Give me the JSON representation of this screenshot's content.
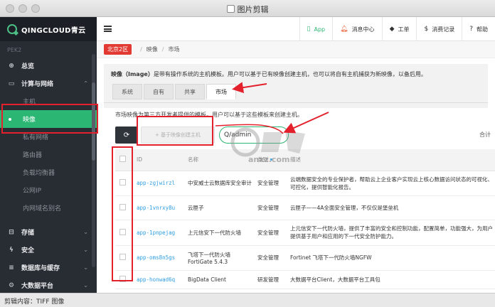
{
  "window": {
    "title": "图片剪辑"
  },
  "status_bar": {
    "text": "剪辑内容：TIFF 图像"
  },
  "sidebar": {
    "logo": "QINGCLOUD青云",
    "region": "PEK2",
    "items": [
      {
        "label": "总览",
        "icon": "dashboard-icon",
        "glyph": "⊕"
      },
      {
        "label": "计算与网络",
        "icon": "monitor-icon",
        "glyph": "▭",
        "chevron": "⌃"
      },
      {
        "label": "主机"
      },
      {
        "label": "映像"
      },
      {
        "label": "私有网络"
      },
      {
        "label": "路由器"
      },
      {
        "label": "负载均衡器"
      },
      {
        "label": "公网IP"
      },
      {
        "label": "内网域名别名"
      },
      {
        "label": "存储",
        "icon": "storage-icon",
        "glyph": "⊟",
        "chevron": "⌄"
      },
      {
        "label": "安全",
        "icon": "lightning-icon",
        "glyph": "ϟ",
        "chevron": "⌄"
      },
      {
        "label": "数据库与缓存",
        "icon": "database-icon",
        "glyph": "≡",
        "chevron": "⌄"
      },
      {
        "label": "大数据平台",
        "icon": "gear-icon",
        "glyph": "⚙",
        "chevron": "⌄"
      }
    ]
  },
  "header": {
    "app": "App",
    "messages": "消息中心",
    "tickets": "工单",
    "billing": "消费记录",
    "help": "帮助"
  },
  "breadcrumb": {
    "region": "北京2区",
    "section": "映像",
    "page": "市场"
  },
  "intro": {
    "bold": "映像（Image）",
    "text": "是带有操作系统的主机模板。用户可以基于已有映像创建主机，也可以将自有主机捕获为新映像，以备后用。"
  },
  "tabs": [
    "系统",
    "自有",
    "共享",
    "市场"
  ],
  "market_desc": "市场映像为第三方开发者提供的模板。用户可以基于这些模板来创建主机。",
  "toolbar": {
    "refresh_glyph": "⟳",
    "create_label": "+ 基于映像创建主机",
    "search_value": "Q/admin",
    "total_label": "合计"
  },
  "table": {
    "columns": [
      "ID",
      "名称",
      "类别",
      "描述"
    ],
    "rows": [
      {
        "id": "app-zgjwirzl",
        "name": "中安威士云数据库安全审计",
        "category": "安全管理",
        "desc": "云端数据安全的专业保护者，帮助云上企业客户实现云上核心数据访问状态的可视化、可控化，提供智能化报告。"
      },
      {
        "id": "app-1vnrxy8u",
        "name": "云匣子",
        "category": "安全管理",
        "desc": "云匣子——4A全面安全管理，不仅仅是堡垒机"
      },
      {
        "id": "app-1pnpejag",
        "name": "上元信安下一代防火墙",
        "category": "安全管理",
        "desc": "上元信安下一代防火墙，提供了丰富的安全和控制功能，配置简单，功能强大，为用户提供基于用户和应用的下一代安全防护能力。"
      },
      {
        "id": "app-oms8n5gs",
        "name": "飞塔下一代防火墙 FortiGate 5.4.3",
        "category": "安全管理",
        "desc": "Fortinet 飞塔下一代防火墙NGFW"
      },
      {
        "id": "app-honwad6q",
        "name": "BigData Client",
        "category": "研发管理",
        "desc": "大数据平台Client，大数据平台工具包"
      }
    ]
  },
  "watermark": {
    "text": "anxz.com"
  },
  "colors": {
    "accent": "#2bb673",
    "annotation_red": "#e3202c",
    "sidebar_bg": "#282c33",
    "link": "#2f9ee0"
  }
}
